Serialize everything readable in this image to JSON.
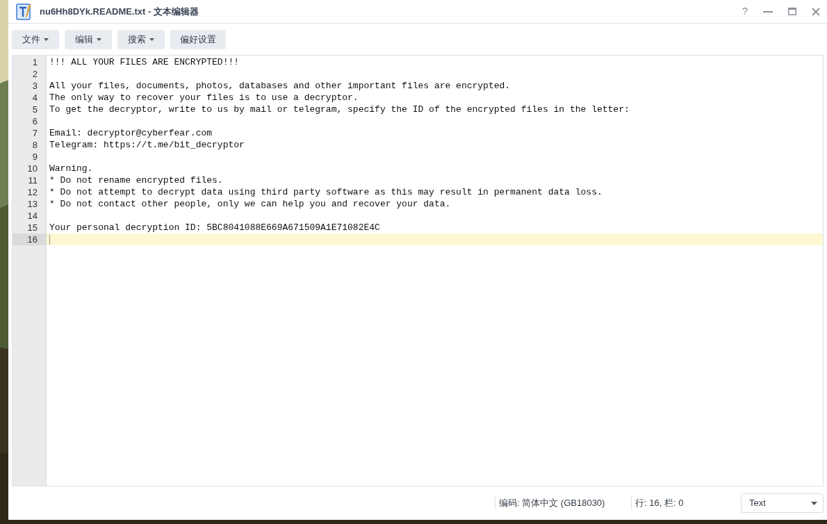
{
  "window": {
    "title": "nu6Hh8DYk.README.txt - 文本编辑器",
    "controls": [
      "?"
    ]
  },
  "menus": [
    {
      "label": "文件",
      "dropdown": true
    },
    {
      "label": "编辑",
      "dropdown": true
    },
    {
      "label": "搜索",
      "dropdown": true
    },
    {
      "label": "偏好设置",
      "dropdown": false
    }
  ],
  "editor": {
    "lines": [
      {
        "number": "1",
        "text": "!!! ALL YOUR FILES ARE ENCRYPTED!!!",
        "selected": false
      },
      {
        "number": "2",
        "selected": false
      },
      {
        "number": "3",
        "text": "All your files, documents, photos, databases and other important files are encrypted.",
        "selected": false
      },
      {
        "number": "4",
        "text": "The only way to recover your files is to use a decryptor.",
        "selected": false
      },
      {
        "number": "5",
        "text": "To get the decryptor, write to us by mail or telegram, specify the ID of the encrypted files in the letter:",
        "selected": false
      },
      {
        "number": "6",
        "selected": false
      },
      {
        "number": "7",
        "text": "Email: decryptor@cyberfear.com",
        "selected": false
      },
      {
        "number": "8",
        "text": "Telegram: https://t.me/bit_decryptor",
        "selected": false
      },
      {
        "number": "9",
        "selected": false
      },
      {
        "number": "10",
        "text": "Warning.",
        "selected": false
      },
      {
        "number": "11",
        "text": "* Do not rename encrypted files.",
        "selected": false
      },
      {
        "number": "12",
        "text": "* Do not attempt to decrypt data using third party software as this may result in permanent data loss.",
        "selected": false
      },
      {
        "number": "13",
        "text": "* Do not contact other people, only we can help you and recover your data.",
        "selected": false
      },
      {
        "number": "14",
        "selected": false
      },
      {
        "number": "15",
        "text": "Your personal decryption ID: 5BC8041088E669A671509A1E71082E4C",
        "selected": false
      },
      {
        "number": "16",
        "selected": true
      }
    ]
  },
  "status_bar": {
    "encoding": "编码: 简体中文 (GB18030)",
    "position": "行: 16, 栏: 0",
    "mode": "Text"
  }
}
